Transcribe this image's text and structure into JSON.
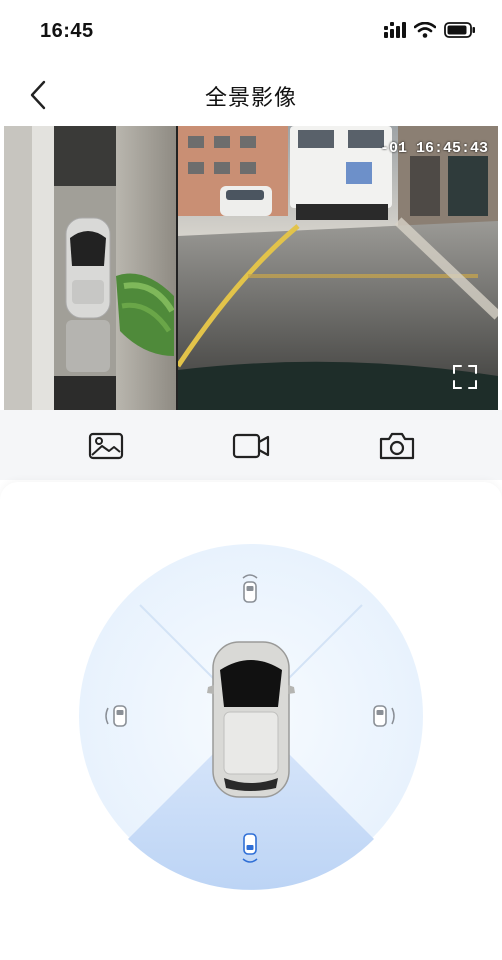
{
  "status_bar": {
    "time": "16:45",
    "icons": [
      "signal-icon",
      "wifi-icon",
      "battery-icon"
    ]
  },
  "nav": {
    "title": "全景影像",
    "back_icon": "chevron-left-icon"
  },
  "video": {
    "timestamp": "-01 16:45:43",
    "fullscreen_icon": "fullscreen-icon"
  },
  "toolbar": {
    "items": [
      "gallery-icon",
      "video-record-icon",
      "camera-icon"
    ]
  },
  "camera_selector": {
    "selected": "rear",
    "views": [
      "front",
      "left",
      "right",
      "rear"
    ],
    "highlight_color": "#2f6fd6"
  }
}
